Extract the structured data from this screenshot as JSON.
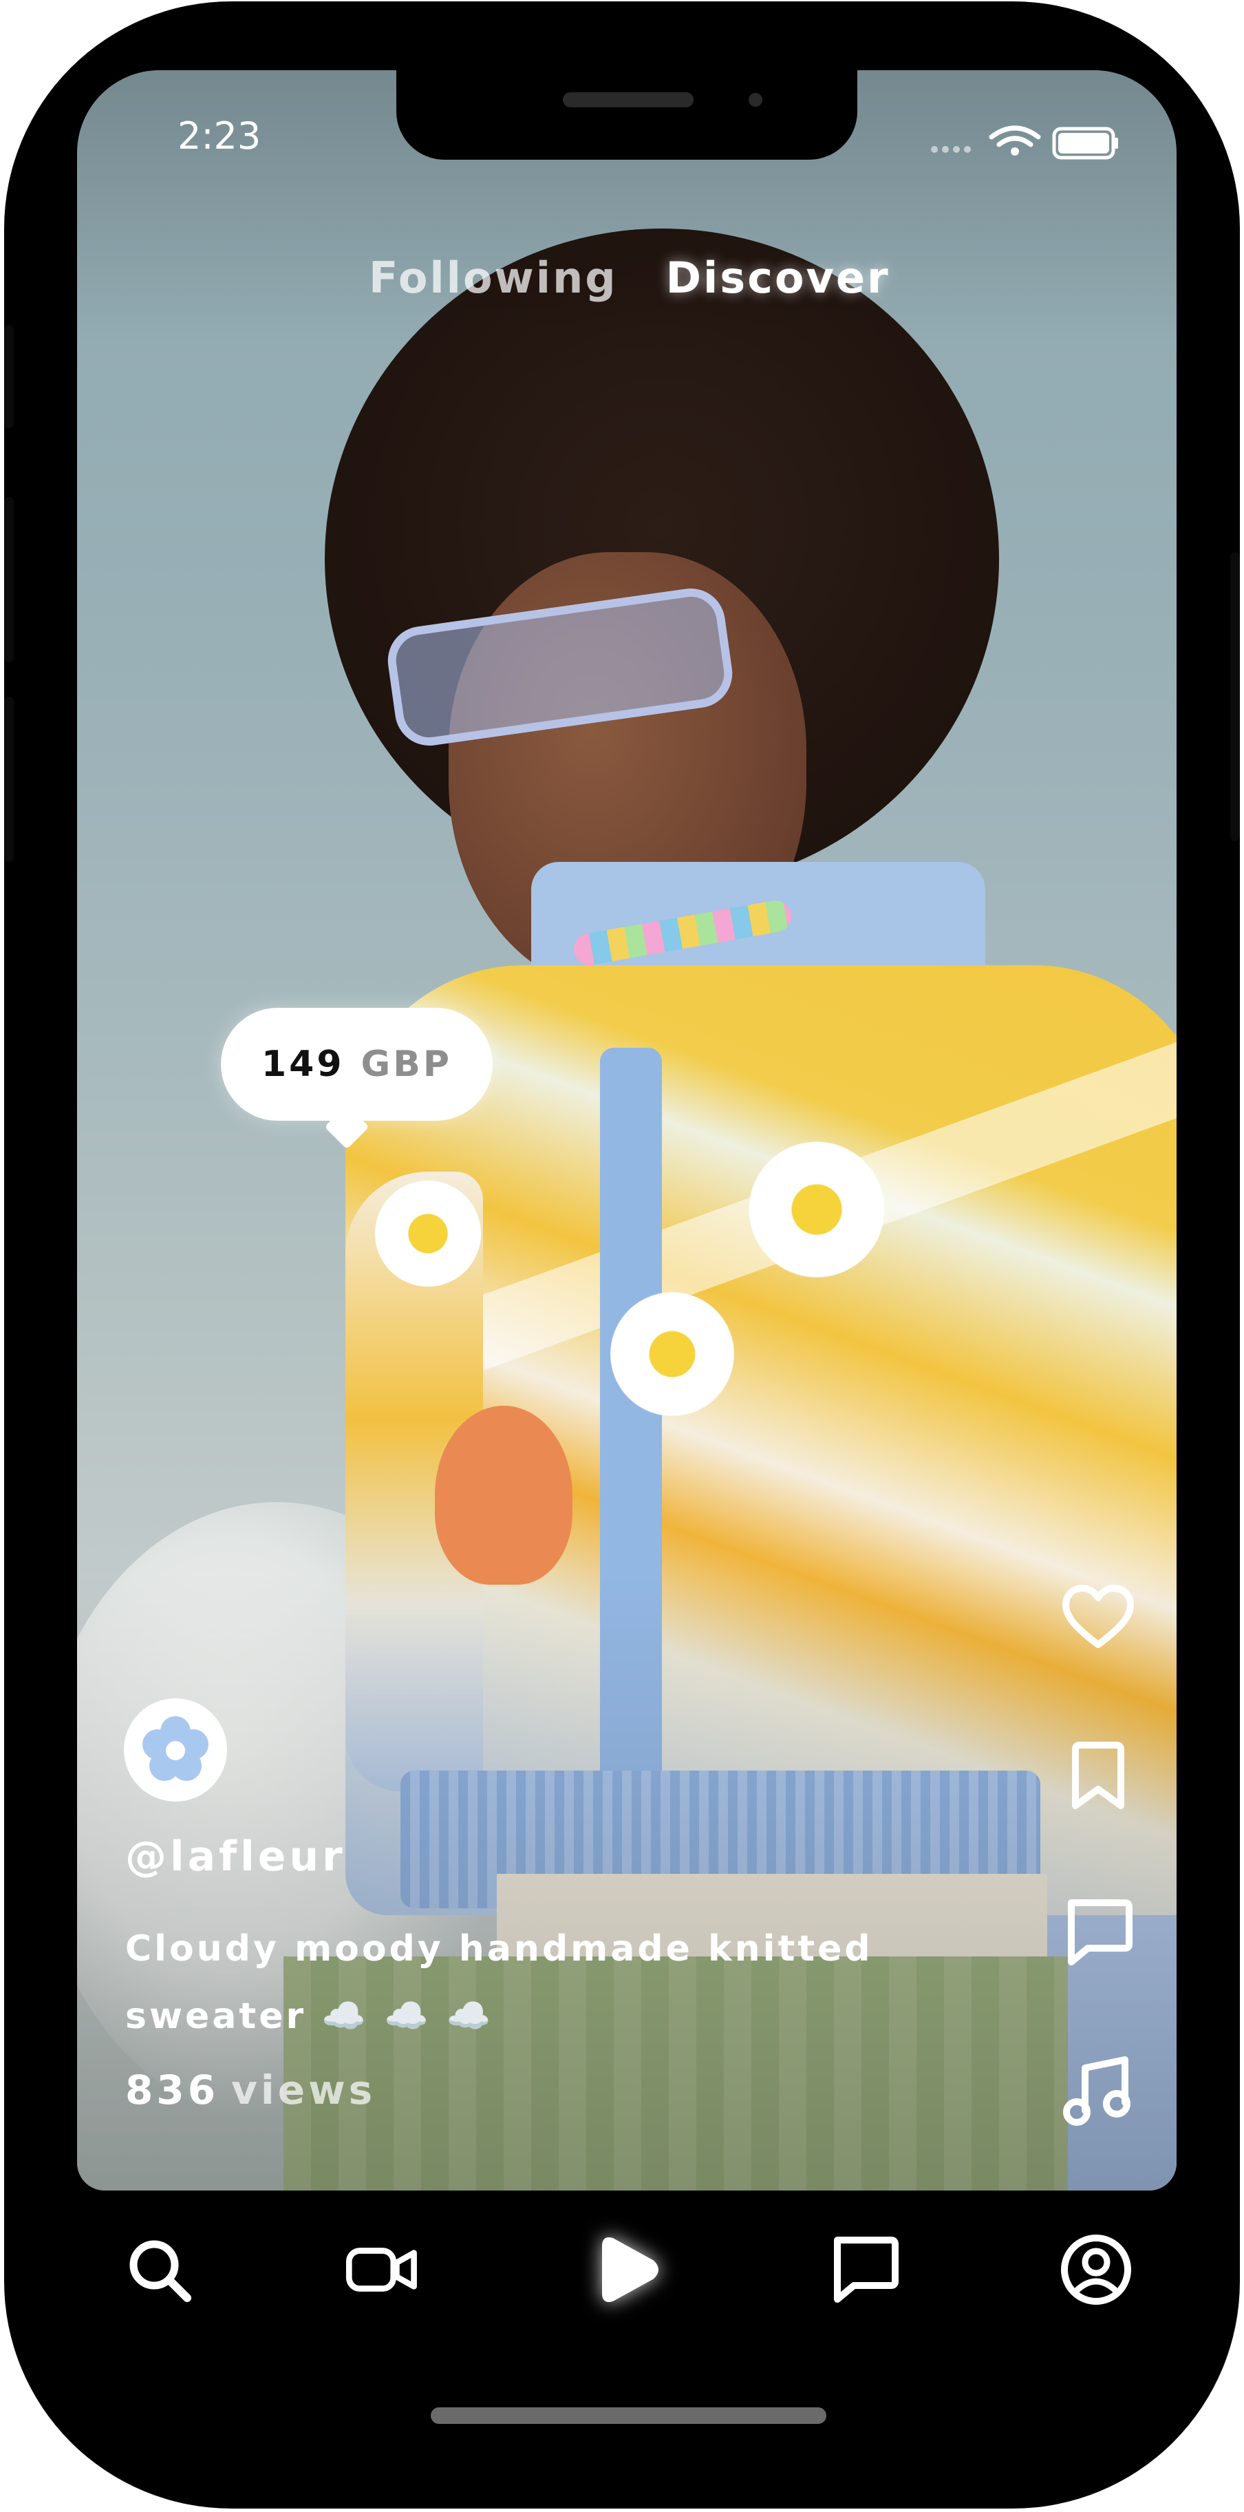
{
  "status_bar": {
    "time": "2:23",
    "icons": [
      "signal-dots-icon",
      "wifi-icon",
      "battery-icon"
    ]
  },
  "feed_tabs": {
    "following": "Following",
    "discover": "Discover",
    "active": "Discover"
  },
  "price_tag": {
    "amount": "149",
    "currency": "GBP"
  },
  "actions": [
    "heart-icon",
    "bookmark-icon",
    "comment-icon",
    "music-note-icon"
  ],
  "post": {
    "avatar_icon": "flower-icon",
    "username": "@lafleur",
    "caption_line1": "Cloudy moody handmade knitted",
    "caption_line2": "sweater ☁️ ☁️ ☁️",
    "views_count": "836",
    "views_label": "views"
  },
  "bottom_nav": {
    "items": [
      "search-icon",
      "video-camera-icon",
      "play-icon",
      "chat-icon",
      "profile-icon"
    ],
    "active": "play-icon"
  },
  "colors": {
    "device": "#000000",
    "text": "#ffffff",
    "price_currency": "#8e8e8e"
  }
}
